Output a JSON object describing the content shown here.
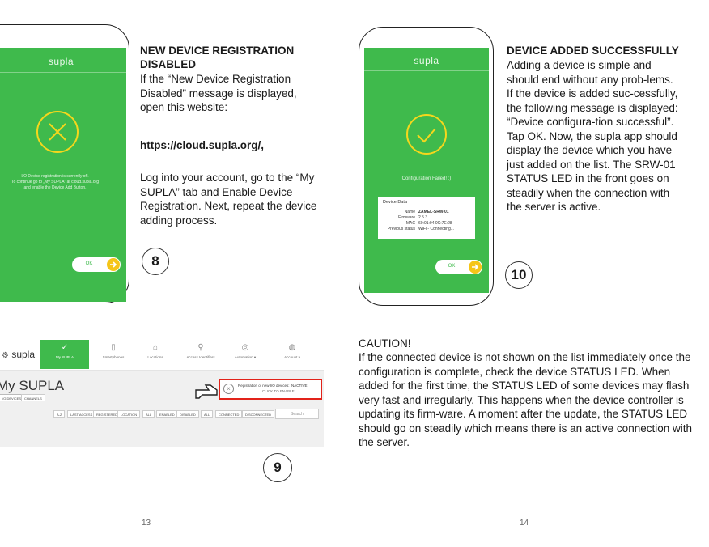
{
  "left_phone": {
    "logo": "supla",
    "message": "I/O Device registration is currently off.\nTo continue go to „My SUPLA” at cloud.supla.org\nand enable the Device Add Button.",
    "ok_label": "OK"
  },
  "right_phone": {
    "logo": "supla",
    "status": "Configuration Failed! :)",
    "card_title": "Device Data",
    "rows": [
      {
        "key": "Name",
        "value": "ZAMEL-SRW-01"
      },
      {
        "key": "Firmware",
        "value": "2.5.3"
      },
      {
        "key": "MAC",
        "value": "60:01:94:0C:7E:28"
      },
      {
        "key": "Previous status",
        "value": "WiFi - Connecting..."
      }
    ],
    "ok_label": "OK"
  },
  "step8": {
    "heading": "NEW DEVICE REGISTRATION DISABLED",
    "para1": "If the “New Device Registration Disabled” message is displayed, open this website:",
    "link": "https://cloud.supla.org/,",
    "para2": "Log into your account, go to the “My SUPLA” tab and Enable Device Registration. Next, repeat the device adding process.",
    "number": "8"
  },
  "step10": {
    "heading": "DEVICE ADDED SUCCESSFULLY",
    "para": "Adding a device is simple and should end without any prob-lems. If the device is added suc-cessfully, the following message is displayed: “Device configura-tion successful”. Tap OK. Now, the supla app should display the device which you have just added on the list. The SRW-01 STATUS LED in the front goes on steadily when the connection with the server is active.",
    "number": "10"
  },
  "step9": {
    "number": "9"
  },
  "web": {
    "logo": "supla",
    "nav": [
      {
        "icon": "✓",
        "label": "My SUPLA"
      },
      {
        "icon": "▯",
        "label": "Smartphones"
      },
      {
        "icon": "⌂",
        "label": "Locations"
      },
      {
        "icon": "⚲",
        "label": "Access Identifiers"
      },
      {
        "icon": "◎",
        "label": "Automation ▾"
      },
      {
        "icon": "◍",
        "label": "Account ▾"
      }
    ],
    "title": "My SUPLA",
    "tabs": [
      "I/O DEVICES",
      "CHANNELS"
    ],
    "banner_line1": "Registration of new I/O devices: INACTIVE",
    "banner_line2": "CLICK TO ENABLE",
    "filters": [
      "A-Z",
      "LAST ACCESS",
      "REGISTERED",
      "LOCATION",
      "ALL",
      "ENABLED",
      "DISABLED",
      "ALL",
      "CONNECTED",
      "DISCONNECTED"
    ],
    "search_placeholder": "Search"
  },
  "caution": {
    "title": "CAUTION!",
    "text": "If the connected device is not shown on the list immediately once the configuration is complete, check the device STATUS LED. When added for the first time, the STATUS LED of some devices may flash very fast and irregularly. This happens when the device controller is updating its firm-ware. A moment after the update, the STATUS LED should go on steadily which means there is an active connection with the server."
  },
  "page_numbers": {
    "left": "13",
    "right": "14"
  }
}
